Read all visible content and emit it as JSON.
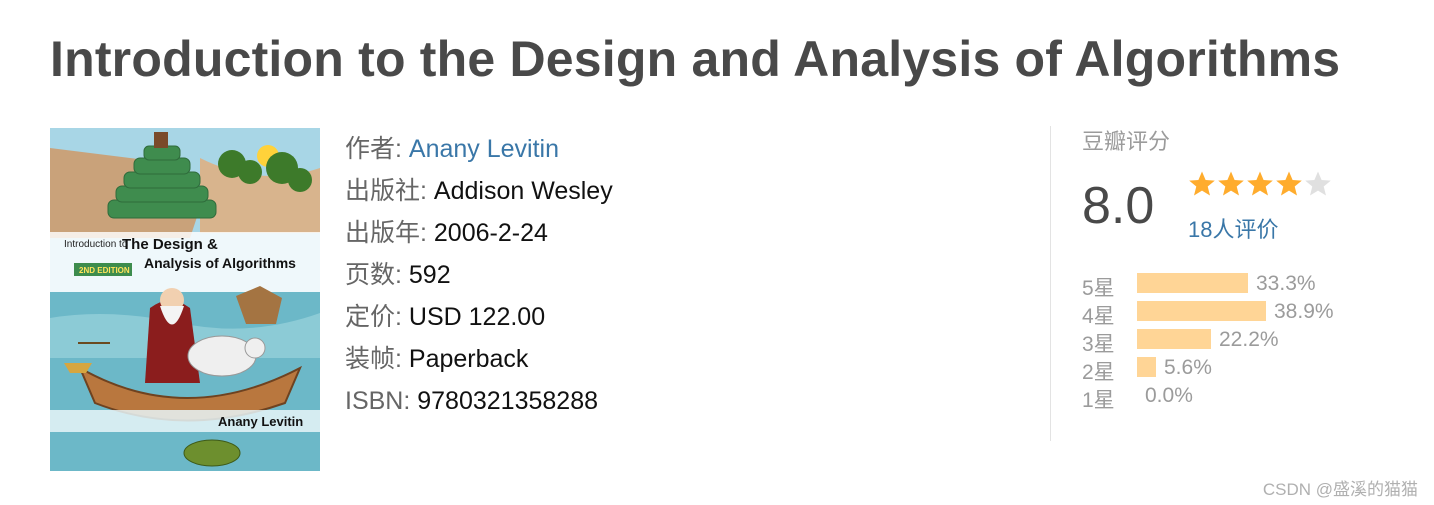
{
  "book": {
    "title": "Introduction to the Design and Analysis of Algorithms",
    "cover": {
      "top_line": "Introduction to",
      "title_line1": "The Design &",
      "title_line2": "Analysis of Algorithms",
      "edition": "2ND EDITION",
      "author": "Anany Levitin"
    },
    "info": [
      {
        "key": "作者:",
        "value": "Anany Levitin",
        "link": true
      },
      {
        "key": "出版社:",
        "value": "Addison Wesley",
        "link": false
      },
      {
        "key": "出版年:",
        "value": "2006-2-24",
        "link": false
      },
      {
        "key": "页数:",
        "value": "592",
        "link": false
      },
      {
        "key": "定价:",
        "value": "USD 122.00",
        "link": false
      },
      {
        "key": "装帧:",
        "value": "Paperback",
        "link": false
      },
      {
        "key": "ISBN:",
        "value": "9780321358288",
        "link": false
      }
    ]
  },
  "rating": {
    "label": "豆瓣评分",
    "score": "8.0",
    "stars_filled": 4,
    "stars_total": 5,
    "count_text": "18人评价",
    "distribution": [
      {
        "label": "5星",
        "percent_text": "33.3%",
        "percent": 33.3
      },
      {
        "label": "4星",
        "percent_text": "38.9%",
        "percent": 38.9
      },
      {
        "label": "3星",
        "percent_text": "22.2%",
        "percent": 22.2
      },
      {
        "label": "2星",
        "percent_text": "5.6%",
        "percent": 5.6
      },
      {
        "label": "1星",
        "percent_text": "0.0%",
        "percent": 0.0
      }
    ],
    "colors": {
      "star": "#ffac2d",
      "star_empty": "#e0e0e0",
      "bar": "#ffd596"
    }
  },
  "watermark": "CSDN @盛溪的猫猫"
}
